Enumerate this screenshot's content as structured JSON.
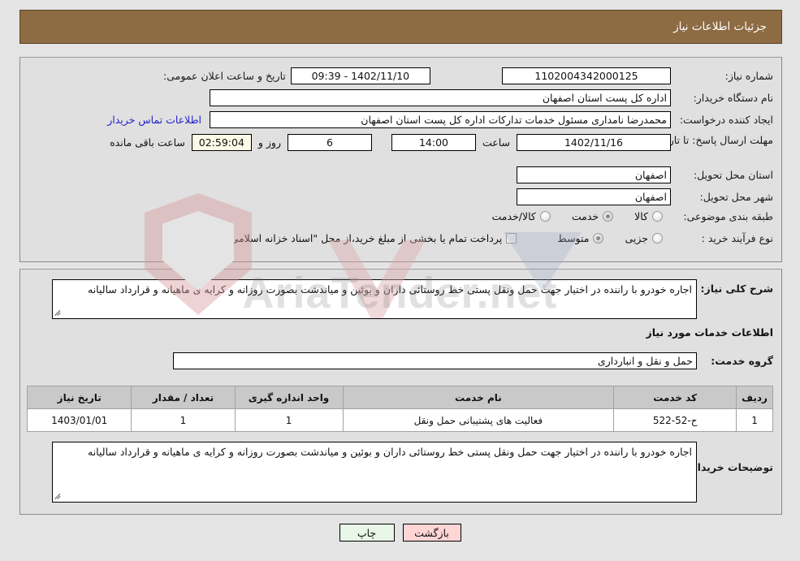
{
  "header": {
    "title": "جزئیات اطلاعات نیاز"
  },
  "watermark": {
    "text": "AriaTender.net"
  },
  "top_panel": {
    "need_number_label": "شماره نیاز:",
    "need_number_value": "1102004342000125",
    "announce_datetime_label": "تاریخ و ساعت اعلان عمومی:",
    "announce_datetime_value": "09:39 - 1402/11/10",
    "buyer_org_label": "نام دستگاه خریدار:",
    "buyer_org_value": "اداره کل پست استان اصفهان",
    "creator_label": "ایجاد کننده درخواست:",
    "creator_value": "محمدرضا نامداری مسئول خدمات تدارکات اداره کل پست استان اصفهان",
    "contact_link": "اطلاعات تماس خریدار",
    "deadline_label": "مهلت ارسال پاسخ: تا تاریخ:",
    "deadline_date": "1402/11/16",
    "hour_label": "ساعت",
    "deadline_time": "14:00",
    "days_value": "6",
    "days_label": "روز و",
    "countdown_value": "02:59:04",
    "remaining_label": "ساعت باقی مانده",
    "province_label": "استان محل تحویل:",
    "province_value": "اصفهان",
    "city_label": "شهر محل تحویل:",
    "city_value": "اصفهان",
    "category_label": "طبقه بندی موضوعی:",
    "category_options": [
      {
        "label": "کالا",
        "checked": false
      },
      {
        "label": "خدمت",
        "checked": true
      },
      {
        "label": "کالا/خدمت",
        "checked": false
      }
    ],
    "process_type_label": "نوع فرآیند خرید :",
    "process_options": [
      {
        "label": "جزیی",
        "checked": false
      },
      {
        "label": "متوسط",
        "checked": true
      }
    ],
    "treasury_checkbox_checked": false,
    "treasury_text": "پرداخت تمام یا بخشی از مبلغ خرید،از محل \"اسناد خزانه اسلامی\" خواهد بود."
  },
  "bottom_panel": {
    "general_desc_label": "شرح کلی نیاز:",
    "general_desc_value": "اجاره خودرو با راننده در اختیار جهت حمل ونقل پستی خط روستائی داران و بوئین و میاندشت بصورت روزانه و کرایه ی ماهیانه و قرارداد سالیانه",
    "services_section_title": "اطلاعات خدمات مورد نیاز",
    "service_group_label": "گروه خدمت:",
    "service_group_value": "حمل و نقل و انبارداری",
    "table": {
      "headers": [
        "ردیف",
        "کد خدمت",
        "نام خدمت",
        "واحد اندازه گیری",
        "تعداد / مقدار",
        "تاریخ نیاز"
      ],
      "rows": [
        {
          "row_no": "1",
          "service_code": "ح-52-522",
          "service_name": "فعالیت های پشتیبانی حمل ونقل",
          "unit": "1",
          "quantity": "1",
          "need_date": "1403/01/01"
        }
      ]
    },
    "buyer_notes_label": "توضیحات خریدار:",
    "buyer_notes_value": "اجاره خودرو با راننده در اختیار جهت حمل ونقل پستی خط روستائی داران و بوئین و میاندشت بصورت روزانه و کرایه ی ماهیانه و قرارداد سالیانه"
  },
  "footer": {
    "print_button": "چاپ",
    "back_button": "بازگشت"
  },
  "colors": {
    "header_bg": "#8d6b43",
    "panel_bg": "#e0e0e0",
    "page_bg": "#e4e4e4",
    "link": "#2222cc",
    "countdown_bg": "#fbfbe8",
    "table_header_bg": "#c9c9c9",
    "back_button_bg": "#ffd5d5",
    "print_button_bg": "#e8f7e8"
  }
}
